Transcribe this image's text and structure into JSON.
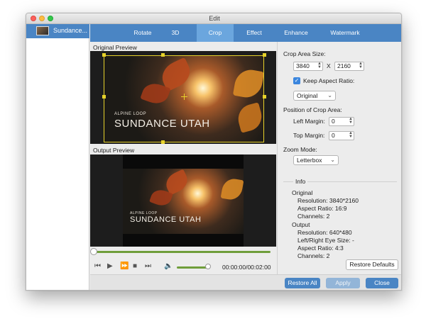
{
  "window": {
    "title": "Edit"
  },
  "sidebar": {
    "items": [
      {
        "label": "Sundance...",
        "selected": true
      }
    ]
  },
  "tabs": [
    {
      "label": "Rotate",
      "active": false
    },
    {
      "label": "3D",
      "active": false
    },
    {
      "label": "Crop",
      "active": true
    },
    {
      "label": "Effect",
      "active": false
    },
    {
      "label": "Enhance",
      "active": false
    },
    {
      "label": "Watermark",
      "active": false
    }
  ],
  "preview": {
    "original_label": "Original Preview",
    "output_label": "Output Preview",
    "overlay_small": "ALPINE LOOP",
    "overlay_big": "SUNDANCE UTAH"
  },
  "player": {
    "time": "00:00:00/00:02:00",
    "progress": 0.0,
    "volume": 0.95,
    "icons": [
      "skip-back-icon",
      "play-icon",
      "fast-forward-icon",
      "stop-icon",
      "skip-end-icon",
      "volume-icon"
    ]
  },
  "crop": {
    "area_size_label": "Crop Area Size:",
    "width": "3840",
    "separator": "X",
    "height": "2160",
    "keep_aspect_label": "Keep Aspect Ratio:",
    "keep_aspect_checked": true,
    "aspect_value": "Original",
    "position_label": "Position of Crop Area:",
    "left_margin_label": "Left Margin:",
    "left_margin": "0",
    "top_margin_label": "Top Margin:",
    "top_margin": "0",
    "zoom_label": "Zoom Mode:",
    "zoom_value": "Letterbox"
  },
  "info": {
    "title": "Info",
    "original_title": "Original",
    "original_resolution": "Resolution: 3840*2160",
    "original_aspect": "Aspect Ratio: 16:9",
    "original_channels": "Channels: 2",
    "output_title": "Output",
    "output_resolution": "Resolution: 640*480",
    "output_eye": "Left/Right Eye Size: -",
    "output_aspect": "Aspect Ratio: 4:3",
    "output_channels": "Channels: 2"
  },
  "buttons": {
    "restore_defaults": "Restore Defaults",
    "restore_all": "Restore All",
    "apply": "Apply",
    "close": "Close"
  },
  "colors": {
    "accent": "#4a85c4",
    "active_tab": "#6ba6de",
    "crop_box": "#e6d22b",
    "timeline": "#6f9e3b"
  }
}
